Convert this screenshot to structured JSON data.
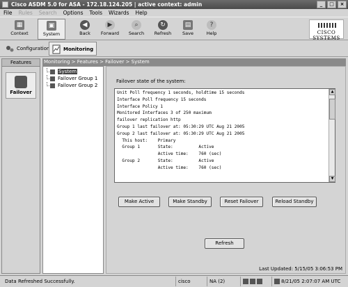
{
  "window": {
    "title": "Cisco ASDM 5.0 for ASA - 172.18.124.205 | active context: admin",
    "controls": [
      "_",
      "□",
      "×"
    ]
  },
  "menu": [
    {
      "label": "File",
      "disabled": false
    },
    {
      "label": "Rules",
      "disabled": true
    },
    {
      "label": "Search",
      "disabled": true
    },
    {
      "label": "Options",
      "disabled": false
    },
    {
      "label": "Tools",
      "disabled": false
    },
    {
      "label": "Wizards",
      "disabled": false
    },
    {
      "label": "Help",
      "disabled": false
    }
  ],
  "toolbar": {
    "context": "Context",
    "system": "System",
    "back": "Back",
    "forward": "Forward",
    "search": "Search",
    "refresh": "Refresh",
    "save": "Save",
    "help": "Help",
    "logo": "CISCO SYSTEMS"
  },
  "modes": {
    "configuration": "Configuration",
    "monitoring": "Monitoring"
  },
  "features": {
    "header": "Features",
    "failover": "Failover"
  },
  "breadcrumb": "Monitoring > Features > Failover > System",
  "tree": [
    {
      "label": "System",
      "selected": true
    },
    {
      "label": "Failover Group 1",
      "selected": false
    },
    {
      "label": "Failover Group 2",
      "selected": false
    }
  ],
  "panel": {
    "heading": "Failover state of the system:",
    "status_lines": [
      "Unit Poll frequency 1 seconds, holdtime 15 seconds",
      "Interface Poll frequency 15 seconds",
      "Interface Policy 1",
      "Monitored Interfaces 3 of 250 maximum",
      "failover replication http",
      "Group 1 last failover at: 05:30:29 UTC Aug 21 2005",
      "Group 2 last failover at: 05:30:29 UTC Aug 21 2005",
      "",
      "  This host:    Primary",
      "  Group 1       State:          Active",
      "                Active time:    760 (sec)",
      "  Group 2       State:          Active",
      "                Active time:    760 (sec)"
    ],
    "buttons": {
      "make_active": "Make Active",
      "make_standby": "Make Standby",
      "reset_failover": "Reset Failover",
      "reload_standby": "Reload Standby",
      "refresh": "Refresh"
    },
    "last_updated": "Last Updated: 5/15/05 3:06:53 PM"
  },
  "statusbar": {
    "message": "Data Refreshed Successfully.",
    "user": "cisco",
    "privilege": "NA (2)",
    "datetime": "8/21/05 2:07:07 AM UTC"
  }
}
